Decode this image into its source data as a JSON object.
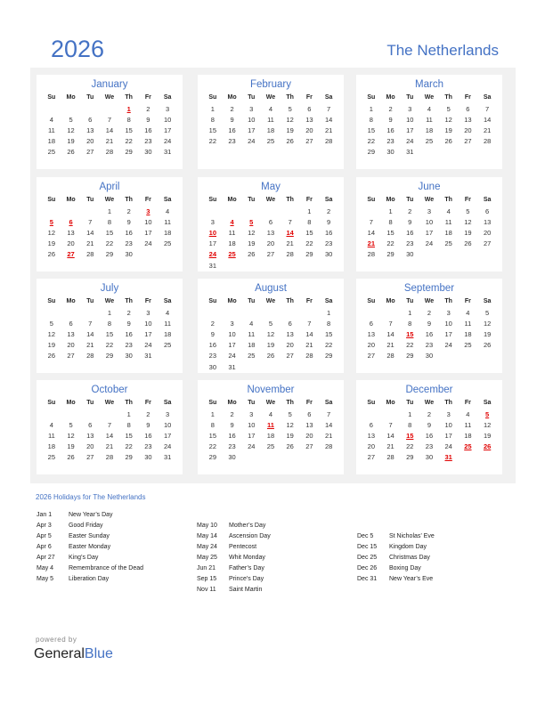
{
  "header": {
    "year": "2026",
    "country": "The Netherlands"
  },
  "weekdays": [
    "Su",
    "Mo",
    "Tu",
    "We",
    "Th",
    "Fr",
    "Sa"
  ],
  "accent_color": "#4472c4",
  "holiday_color": "#e00000",
  "months": [
    {
      "name": "January",
      "start": 4,
      "days": 31,
      "holidays": [
        1
      ]
    },
    {
      "name": "February",
      "start": 0,
      "days": 28,
      "holidays": []
    },
    {
      "name": "March",
      "start": 0,
      "days": 31,
      "holidays": []
    },
    {
      "name": "April",
      "start": 3,
      "days": 30,
      "holidays": [
        3,
        5,
        6,
        27
      ]
    },
    {
      "name": "May",
      "start": 5,
      "days": 31,
      "holidays": [
        4,
        5,
        10,
        14,
        24,
        25
      ]
    },
    {
      "name": "June",
      "start": 1,
      "days": 30,
      "holidays": [
        21
      ]
    },
    {
      "name": "July",
      "start": 3,
      "days": 31,
      "holidays": []
    },
    {
      "name": "August",
      "start": 6,
      "days": 31,
      "holidays": []
    },
    {
      "name": "September",
      "start": 2,
      "days": 30,
      "holidays": [
        15
      ]
    },
    {
      "name": "October",
      "start": 4,
      "days": 31,
      "holidays": []
    },
    {
      "name": "November",
      "start": 0,
      "days": 30,
      "holidays": [
        11
      ]
    },
    {
      "name": "December",
      "start": 2,
      "days": 31,
      "holidays": [
        5,
        15,
        25,
        26,
        31
      ]
    }
  ],
  "holidays_section": {
    "title": "2026 Holidays for The Netherlands",
    "columns": [
      [
        {
          "date": "Jan 1",
          "name": "New Year’s Day"
        },
        {
          "date": "Apr 3",
          "name": "Good Friday"
        },
        {
          "date": "Apr 5",
          "name": "Easter Sunday"
        },
        {
          "date": "Apr 6",
          "name": "Easter Monday"
        },
        {
          "date": "Apr 27",
          "name": "King’s Day"
        },
        {
          "date": "May 4",
          "name": "Remembrance of the Dead"
        },
        {
          "date": "May 5",
          "name": "Liberation Day"
        }
      ],
      [
        {
          "date": "May 10",
          "name": "Mother’s Day"
        },
        {
          "date": "May 14",
          "name": "Ascension Day"
        },
        {
          "date": "May 24",
          "name": "Pentecost"
        },
        {
          "date": "May 25",
          "name": "Whit Monday"
        },
        {
          "date": "Jun 21",
          "name": "Father’s Day"
        },
        {
          "date": "Sep 15",
          "name": "Prince’s Day"
        },
        {
          "date": "Nov 11",
          "name": "Saint Martin"
        }
      ],
      [
        {
          "date": "Dec 5",
          "name": "St Nicholas’ Eve"
        },
        {
          "date": "Dec 15",
          "name": "Kingdom Day"
        },
        {
          "date": "Dec 25",
          "name": "Christmas Day"
        },
        {
          "date": "Dec 26",
          "name": "Boxing Day"
        },
        {
          "date": "Dec 31",
          "name": "New Year’s Eve"
        }
      ]
    ]
  },
  "footer": {
    "powered_by": "powered by",
    "brand_general": "General",
    "brand_blue": "Blue"
  }
}
